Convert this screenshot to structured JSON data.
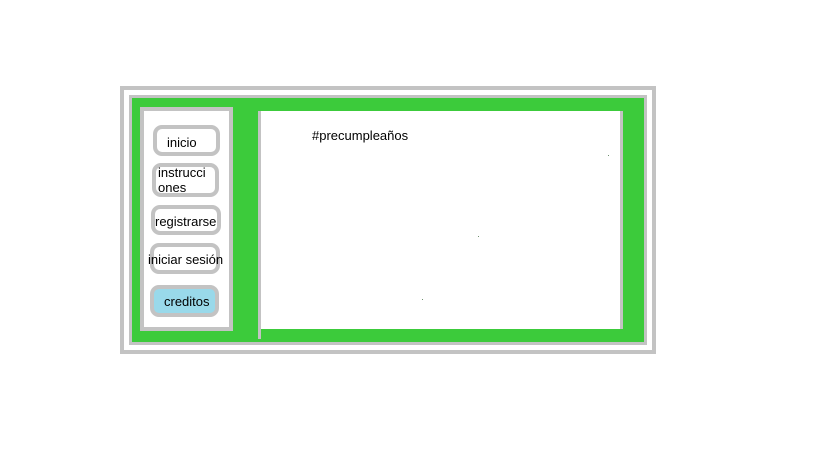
{
  "nav": {
    "items": [
      {
        "id": "inicio",
        "label": "inicio"
      },
      {
        "id": "instrucciones",
        "label": "instrucci ones"
      },
      {
        "id": "registrarse",
        "label": "registrarse"
      },
      {
        "id": "iniciar-sesion",
        "label": "iniciar sesión"
      },
      {
        "id": "creditos",
        "label": "creditos",
        "highlighted": true
      }
    ]
  },
  "content": {
    "hashtag": "#precumpleaños"
  },
  "colors": {
    "frame_green": "#3ccb3b",
    "border_gray": "#c3c3c3",
    "highlight_blue": "#99d9ea",
    "background": "#ffffff"
  }
}
